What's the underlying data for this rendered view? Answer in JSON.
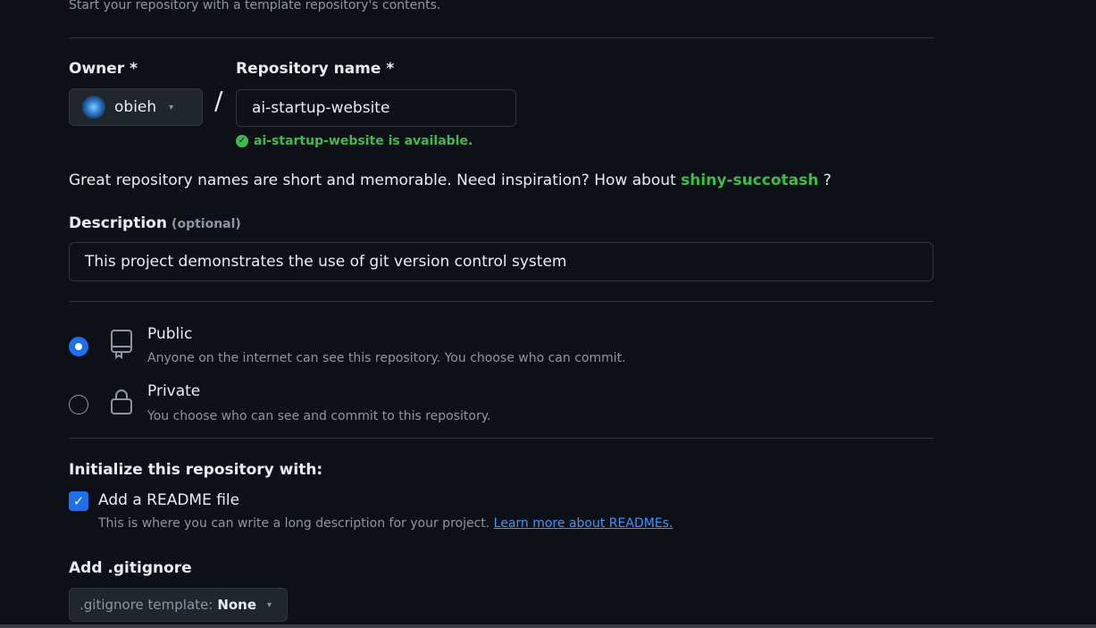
{
  "intro_text": "Start your repository with a template repository's contents.",
  "owner": {
    "label": "Owner *",
    "value": "obieh"
  },
  "repository": {
    "label": "Repository name *",
    "separator": "/",
    "value": "ai-startup-website",
    "availability": "ai-startup-website is available."
  },
  "inspiration": {
    "text": "Great repository names are short and memorable. Need inspiration? How about",
    "suggestion": "shiny-succotash",
    "suffix": "?"
  },
  "description": {
    "label": "Description",
    "optional": "(optional)",
    "value": "This project demonstrates the use of git version control system"
  },
  "visibility": {
    "options": [
      {
        "title": "Public",
        "subtitle": "Anyone on the internet can see this repository. You choose who can commit.",
        "selected": true,
        "icon": "repo-icon"
      },
      {
        "title": "Private",
        "subtitle": "You choose who can see and commit to this repository.",
        "selected": false,
        "icon": "lock-icon"
      }
    ]
  },
  "initialize": {
    "label": "Initialize this repository with:",
    "readme": {
      "checked": true,
      "title": "Add a README file",
      "subtitle": "This is where you can write a long description for your project.",
      "link": "Learn more about READMEs."
    }
  },
  "gitignore": {
    "label": "Add .gitignore",
    "prefix": ".gitignore template:",
    "value": "None"
  },
  "colors": {
    "background": "#0d1117",
    "accent_blue": "#1f6feb",
    "success_green": "#3fb950",
    "link_blue": "#4493f8",
    "muted_text": "#8d96a0"
  }
}
